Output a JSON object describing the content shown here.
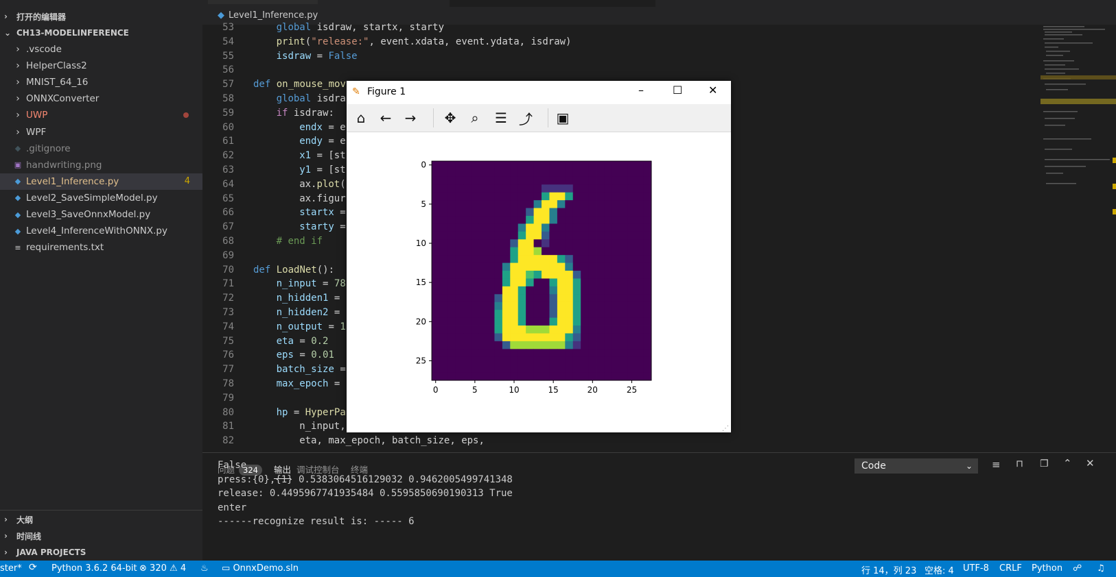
{
  "sidebar": {
    "open_editors": "打开的编辑器",
    "project": "CH13-MODELINFERENCE",
    "items": [
      {
        "label": ".vscode",
        "kind": "folder"
      },
      {
        "label": "HelperClass2",
        "kind": "folder"
      },
      {
        "label": "MNIST_64_16",
        "kind": "folder"
      },
      {
        "label": "ONNXConverter",
        "kind": "folder"
      },
      {
        "label": "UWP",
        "kind": "folder"
      },
      {
        "label": "WPF",
        "kind": "folder"
      },
      {
        "label": ".gitignore",
        "kind": "file"
      },
      {
        "label": "handwriting.png",
        "kind": "image"
      },
      {
        "label": "Level1_Inference.py",
        "kind": "python",
        "badge": "4"
      },
      {
        "label": "Level2_SaveSimpleModel.py",
        "kind": "python"
      },
      {
        "label": "Level3_SaveOnnxModel.py",
        "kind": "python"
      },
      {
        "label": "Level4_InferenceWithONNX.py",
        "kind": "python"
      },
      {
        "label": "requirements.txt",
        "kind": "text"
      }
    ],
    "bottom_sections": [
      "大纲",
      "时间线",
      "JAVA PROJECTS"
    ]
  },
  "editor": {
    "breadcrumb": "Level1_Inference.py",
    "lines": [
      {
        "n": "53",
        "indent": 2,
        "tokens": [
          [
            "kw",
            "global"
          ],
          [
            "t",
            " isdraw, startx, starty"
          ]
        ]
      },
      {
        "n": "54",
        "indent": 2,
        "tokens": [
          [
            "fn",
            "print"
          ],
          [
            "t",
            "("
          ],
          [
            "str",
            "\"release:\""
          ],
          [
            "t",
            ", event.xdata, event.ydata, isdraw)"
          ]
        ]
      },
      {
        "n": "55",
        "indent": 2,
        "tokens": [
          [
            "var",
            "isdraw"
          ],
          [
            "t",
            " = "
          ],
          [
            "kw",
            "False"
          ]
        ]
      },
      {
        "n": "56",
        "indent": 0,
        "tokens": []
      },
      {
        "n": "57",
        "indent": 1,
        "tokens": [
          [
            "kw",
            "def"
          ],
          [
            "t",
            " "
          ],
          [
            "fn",
            "on_mouse_mov"
          ]
        ]
      },
      {
        "n": "58",
        "indent": 2,
        "tokens": [
          [
            "kw",
            "global"
          ],
          [
            "t",
            " isdra"
          ]
        ]
      },
      {
        "n": "59",
        "indent": 2,
        "tokens": [
          [
            "ctl",
            "if"
          ],
          [
            "t",
            " isdraw:"
          ]
        ]
      },
      {
        "n": "60",
        "indent": 3,
        "tokens": [
          [
            "var",
            "endx"
          ],
          [
            "t",
            " = e"
          ]
        ]
      },
      {
        "n": "61",
        "indent": 3,
        "tokens": [
          [
            "var",
            "endy"
          ],
          [
            "t",
            " = e"
          ]
        ]
      },
      {
        "n": "62",
        "indent": 3,
        "tokens": [
          [
            "var",
            "x1"
          ],
          [
            "t",
            " = [st"
          ]
        ]
      },
      {
        "n": "63",
        "indent": 3,
        "tokens": [
          [
            "var",
            "y1"
          ],
          [
            "t",
            " = [st"
          ]
        ]
      },
      {
        "n": "64",
        "indent": 3,
        "tokens": [
          [
            "t",
            "ax."
          ],
          [
            "fn",
            "plot"
          ],
          [
            "t",
            "("
          ]
        ]
      },
      {
        "n": "65",
        "indent": 3,
        "tokens": [
          [
            "t",
            "ax.figur"
          ]
        ]
      },
      {
        "n": "66",
        "indent": 3,
        "tokens": [
          [
            "var",
            "startx"
          ],
          [
            "t",
            " ="
          ]
        ]
      },
      {
        "n": "67",
        "indent": 3,
        "tokens": [
          [
            "var",
            "starty"
          ],
          [
            "t",
            " ="
          ]
        ]
      },
      {
        "n": "68",
        "indent": 2,
        "tokens": [
          [
            "cm",
            "# end if"
          ]
        ]
      },
      {
        "n": "69",
        "indent": 0,
        "tokens": []
      },
      {
        "n": "70",
        "indent": 1,
        "tokens": [
          [
            "kw",
            "def"
          ],
          [
            "t",
            " "
          ],
          [
            "fn",
            "LoadNet"
          ],
          [
            "t",
            "():"
          ]
        ]
      },
      {
        "n": "71",
        "indent": 2,
        "tokens": [
          [
            "var",
            "n_input"
          ],
          [
            "t",
            " = "
          ],
          [
            "num",
            "78"
          ]
        ]
      },
      {
        "n": "72",
        "indent": 2,
        "tokens": [
          [
            "var",
            "n_hidden1"
          ],
          [
            "t",
            " ="
          ]
        ]
      },
      {
        "n": "73",
        "indent": 2,
        "tokens": [
          [
            "var",
            "n_hidden2"
          ],
          [
            "t",
            " ="
          ]
        ]
      },
      {
        "n": "74",
        "indent": 2,
        "tokens": [
          [
            "var",
            "n_output"
          ],
          [
            "t",
            " = "
          ],
          [
            "num",
            "1"
          ]
        ]
      },
      {
        "n": "75",
        "indent": 2,
        "tokens": [
          [
            "var",
            "eta"
          ],
          [
            "t",
            " = "
          ],
          [
            "num",
            "0.2"
          ]
        ]
      },
      {
        "n": "76",
        "indent": 2,
        "tokens": [
          [
            "var",
            "eps"
          ],
          [
            "t",
            " = "
          ],
          [
            "num",
            "0.01"
          ]
        ]
      },
      {
        "n": "77",
        "indent": 2,
        "tokens": [
          [
            "var",
            "batch_size"
          ],
          [
            "t",
            " ="
          ]
        ]
      },
      {
        "n": "78",
        "indent": 2,
        "tokens": [
          [
            "var",
            "max_epoch"
          ],
          [
            "t",
            " ="
          ]
        ]
      },
      {
        "n": "79",
        "indent": 0,
        "tokens": []
      },
      {
        "n": "80",
        "indent": 2,
        "tokens": [
          [
            "var",
            "hp"
          ],
          [
            "t",
            " = "
          ],
          [
            "fn",
            "HyperPa"
          ]
        ]
      },
      {
        "n": "81",
        "indent": 3,
        "tokens": [
          [
            "t",
            "n_input,"
          ]
        ]
      },
      {
        "n": "82",
        "indent": 3,
        "tokens": [
          [
            "t",
            "eta, max_epoch, batch_size, eps,"
          ]
        ]
      }
    ]
  },
  "panel": {
    "tabs": [
      {
        "label": "问题",
        "count": "324"
      },
      {
        "label": "输出",
        "active": true
      },
      {
        "label": "调试控制台"
      },
      {
        "label": "终端"
      }
    ],
    "dropdown_value": "Code",
    "output_lines": [
      "False",
      "press:{0},{1} 0.5383064516129032 0.9462005499741348",
      "release: 0.4495967741935484 0.5595850690190313 True",
      "enter",
      "------recognize result is: ----- 6"
    ]
  },
  "statusbar": {
    "branch": "ster*",
    "python": "Python 3.6.2 64-bit",
    "errors": "320",
    "warnings": "4",
    "solution": "OnnxDemo.sln",
    "cursor": "行 14，列 23",
    "spaces": "空格: 4",
    "encoding": "UTF-8",
    "eol": "CRLF",
    "language": "Python"
  },
  "figure": {
    "title": "Figure 1",
    "toolbar": [
      "home-icon",
      "back-icon",
      "forward-icon",
      "pan-icon",
      "zoom-icon",
      "configure-icon",
      "edit-axis-icon",
      "save-icon"
    ]
  },
  "chart_data": {
    "type": "heatmap",
    "title": "",
    "xlabel": "",
    "ylabel": "",
    "xlim": [
      -0.5,
      27.5
    ],
    "ylim": [
      27.5,
      -0.5
    ],
    "xticks": [
      "0",
      "5",
      "10",
      "15",
      "20",
      "25"
    ],
    "yticks": [
      "0",
      "5",
      "10",
      "15",
      "20",
      "25"
    ],
    "colormap": "viridis",
    "rows": [
      "............................",
      "............................",
      "............................",
      "..............1111..........",
      "..............5995..........",
      ".............3993...........",
      "............2993............",
      "............5993............",
      "...........3993.............",
      "...........5992.............",
      "..........29941.............",
      "..........5998..............",
      "..........59999952..........",
      ".........399999993..........",
      ".........5996599992.........",
      ".........5995..5995.........",
      ".........995...3995.........",
      "........2995...2995.........",
      "........3995...2995.........",
      "........5995...2995.........",
      "........5995...5995.........",
      "........59998889993.........",
      "........29999999952.........",
      ".........2888888831.........",
      "............................",
      "............................",
      "............................",
      "............................"
    ]
  }
}
